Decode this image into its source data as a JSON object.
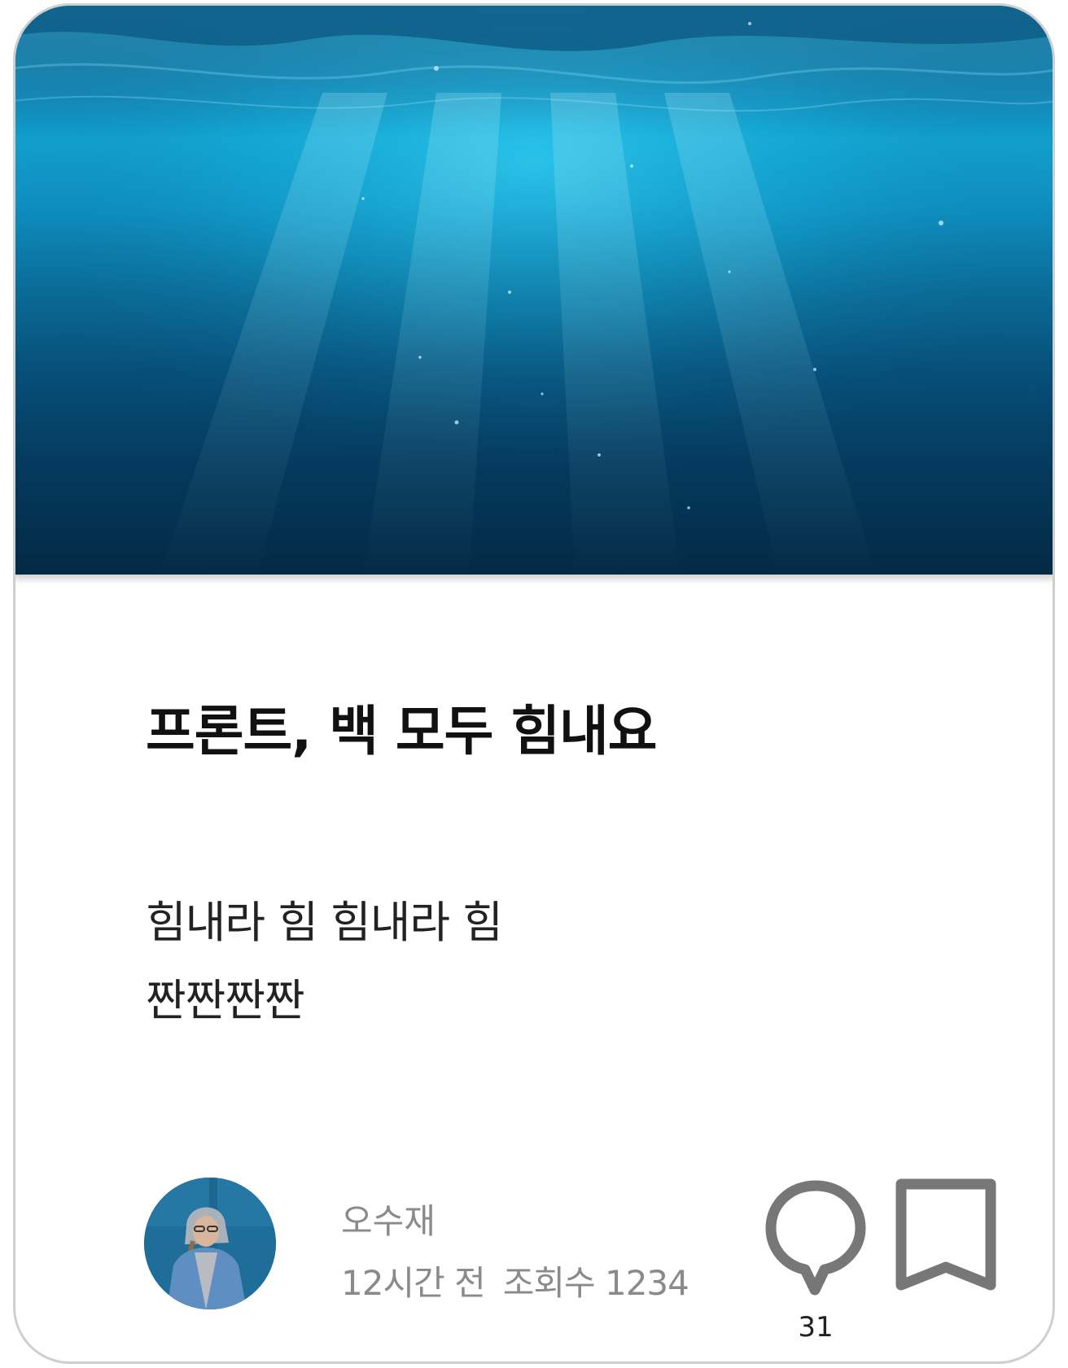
{
  "post": {
    "hero_image": "underwater-ocean-photo",
    "title": "프론트, 백 모두 힘내요",
    "body_lines": [
      "힘내라 힘 힘내라 힘",
      "짠짠짠짠"
    ]
  },
  "author": {
    "name": "오수재",
    "avatar": "person-in-denim-jacket-photo",
    "time_ago": "12시간 전",
    "views_label": "조회수 1234"
  },
  "actions": {
    "comment_icon": "comment-icon",
    "comment_count": "31",
    "bookmark_icon": "bookmark-icon"
  },
  "colors": {
    "title": "#111111",
    "meta": "#8a8a8a",
    "icon": "#777777",
    "card_border": "#cfcfcf"
  }
}
